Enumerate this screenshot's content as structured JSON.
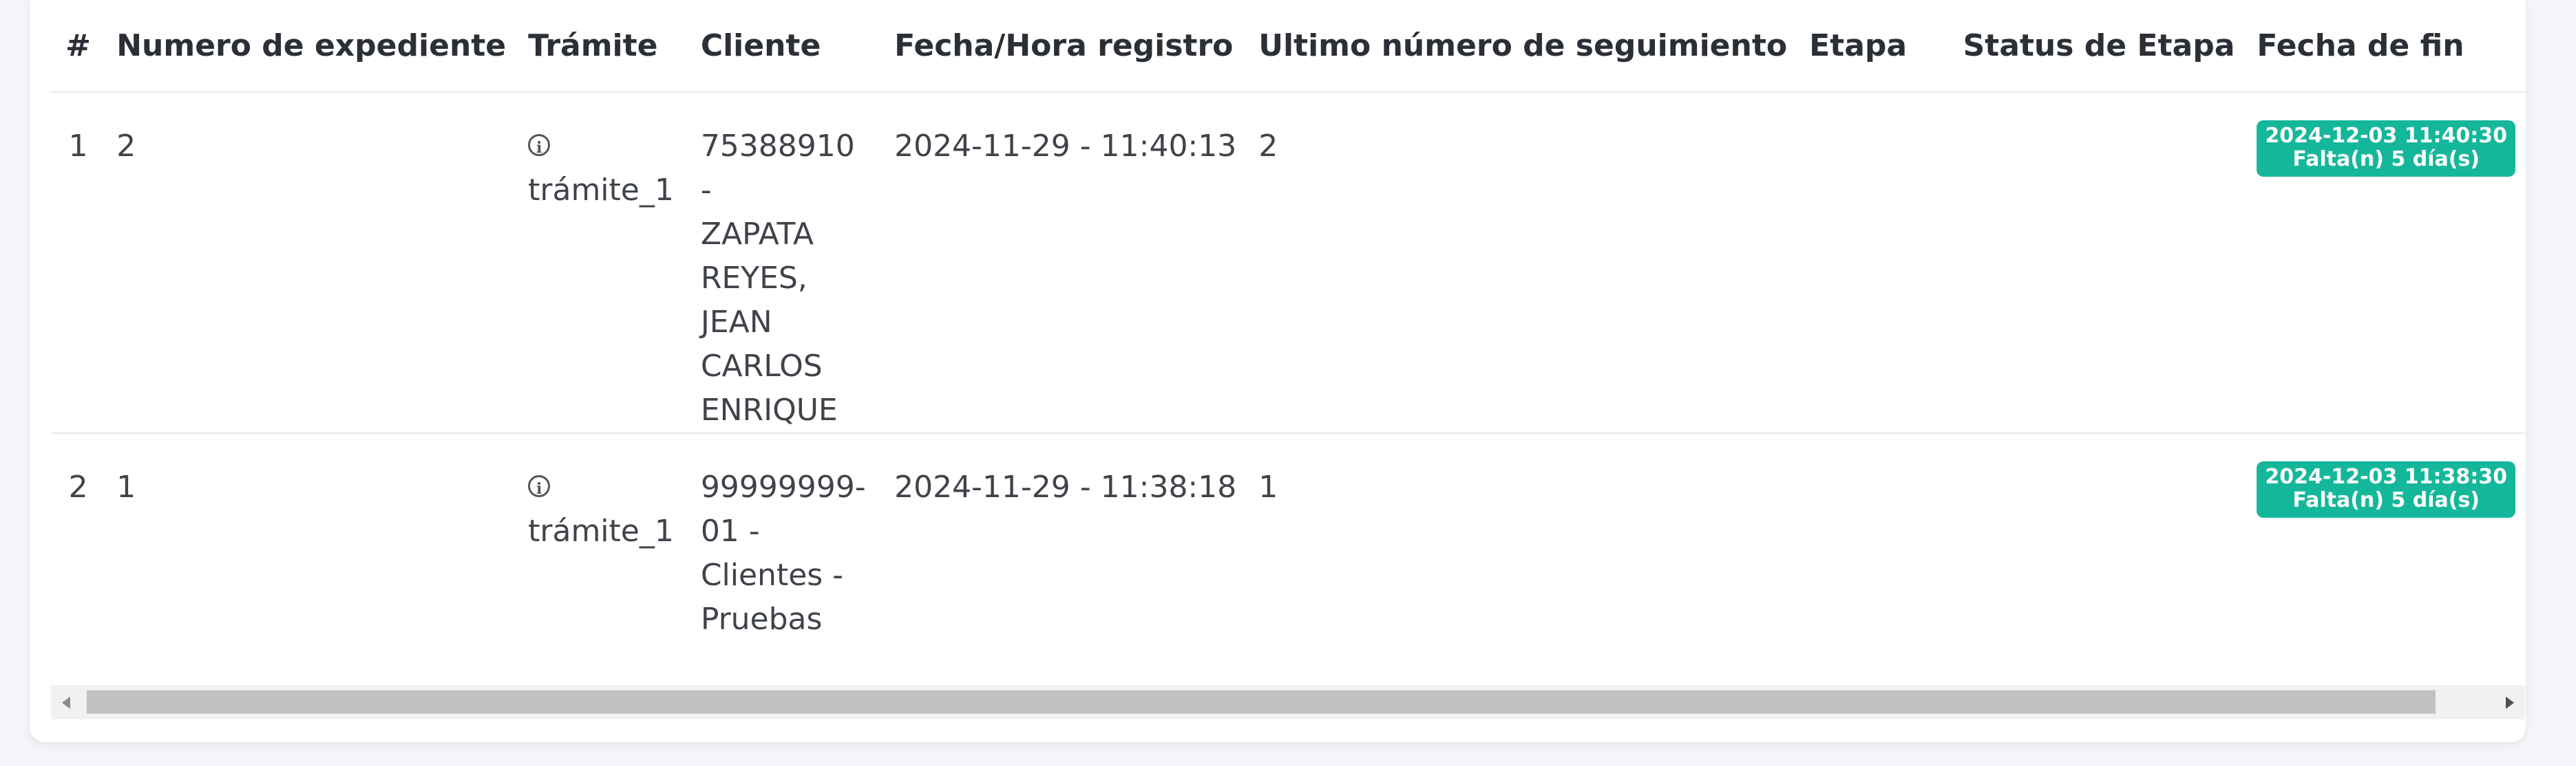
{
  "table": {
    "headers": [
      "#",
      "Numero de expediente",
      "Trámite",
      "Cliente",
      "Fecha/Hora registro",
      "Ultimo número de seguimiento",
      "Etapa",
      "Status de Etapa",
      "Fecha de fin"
    ],
    "rows": [
      {
        "index": "1",
        "expediente": "2",
        "tramite": "trámite_1",
        "cliente_lines": [
          "75388910 -",
          "ZAPATA",
          "REYES,",
          "JEAN",
          "CARLOS",
          "ENRIQUE"
        ],
        "fecha_registro": "2024-11-29 - 11:40:13",
        "ultimo_seguimiento": "2",
        "etapa": "",
        "status_etapa": "",
        "fecha_fin_line1": "2024-12-03 11:40:30",
        "fecha_fin_line2": "Falta(n) 5 día(s)"
      },
      {
        "index": "2",
        "expediente": "1",
        "tramite": "trámite_1",
        "cliente_lines": [
          "99999999-",
          "01 -",
          "Clientes -",
          "Pruebas"
        ],
        "fecha_registro": "2024-11-29 - 11:38:18",
        "ultimo_seguimiento": "1",
        "etapa": "",
        "status_etapa": "",
        "fecha_fin_line1": "2024-12-03 11:38:30",
        "fecha_fin_line2": "Falta(n) 5 día(s)"
      }
    ]
  },
  "icons": {
    "tramite": "info-circle-icon",
    "scroll_left": "arrow-left-icon",
    "scroll_right": "arrow-right-icon"
  },
  "colors": {
    "badge": "#15b79a",
    "scroll_thumb": "#c1c1c1"
  }
}
